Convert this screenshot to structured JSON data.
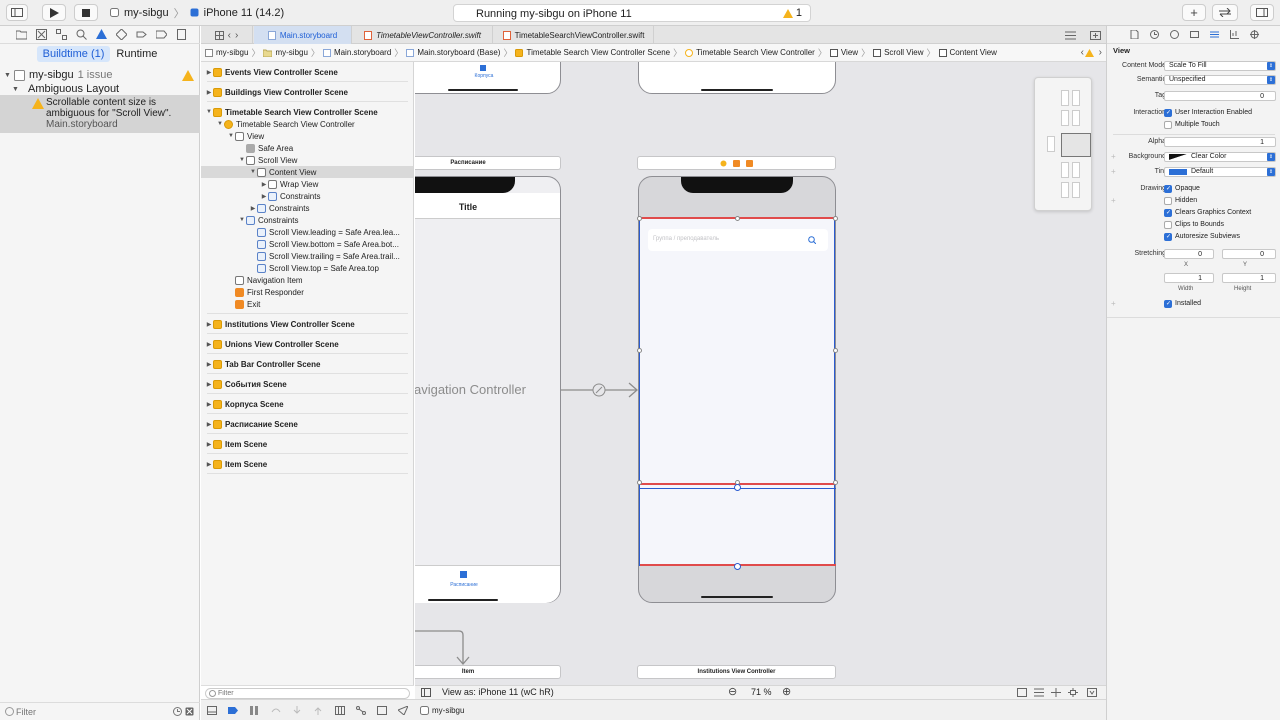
{
  "toolbar": {
    "scheme_name": "my-sibgu",
    "device_name": "iPhone 11 (14.2)",
    "activity_text": "Running my-sibgu on iPhone 11",
    "warning_count": "1"
  },
  "navigator": {
    "segments": [
      "Buildtime (1)",
      "Runtime"
    ],
    "project": "my-sibgu",
    "issue_count": "1 issue",
    "group": "Ambiguous Layout",
    "issue_line1": "Scrollable content size is",
    "issue_line2": "ambiguous for \"Scroll View\".",
    "issue_file": "Main.storyboard",
    "filter_placeholder": "Filter"
  },
  "tabs": [
    "Main.storyboard",
    "TimetableViewController.swift",
    "TimetableSearchViewController.swift"
  ],
  "jumpbar": [
    "my-sibgu",
    "my-sibgu",
    "Main.storyboard",
    "Main.storyboard (Base)",
    "Timetable Search View Controller Scene",
    "Timetable Search View Controller",
    "View",
    "Scroll View",
    "Content View"
  ],
  "outline": {
    "rows": [
      {
        "label": "Events View Controller Scene",
        "kind": "scene"
      },
      {
        "label": "Buildings View Controller Scene",
        "kind": "scene"
      },
      {
        "label": "Timetable Search View Controller Scene",
        "kind": "scene-open"
      },
      {
        "label": "Timetable Search View Controller",
        "kind": "vc"
      },
      {
        "label": "View",
        "kind": "view"
      },
      {
        "label": "Safe Area",
        "kind": "leaf"
      },
      {
        "label": "Scroll View",
        "kind": "view"
      },
      {
        "label": "Content View",
        "kind": "view"
      },
      {
        "label": "Wrap View",
        "kind": "view-closed"
      },
      {
        "label": "Constraints",
        "kind": "cons-closed"
      },
      {
        "label": "Constraints",
        "kind": "cons-closed"
      },
      {
        "label": "Constraints",
        "kind": "cons-open"
      },
      {
        "label": "Scroll View.leading = Safe Area.lea...",
        "kind": "constraint"
      },
      {
        "label": "Scroll View.bottom = Safe Area.bot...",
        "kind": "constraint"
      },
      {
        "label": "Scroll View.trailing = Safe Area.trail...",
        "kind": "constraint"
      },
      {
        "label": "Scroll View.top = Safe Area.top",
        "kind": "constraint"
      },
      {
        "label": "Navigation Item",
        "kind": "navitem"
      },
      {
        "label": "First Responder",
        "kind": "responder"
      },
      {
        "label": "Exit",
        "kind": "exit"
      },
      {
        "label": "Institutions View Controller Scene",
        "kind": "scene"
      },
      {
        "label": "Unions View Controller Scene",
        "kind": "scene"
      },
      {
        "label": "Tab Bar Controller Scene",
        "kind": "scene"
      },
      {
        "label": "События Scene",
        "kind": "scene"
      },
      {
        "label": "Корпуса Scene",
        "kind": "scene"
      },
      {
        "label": "Расписание Scene",
        "kind": "scene"
      },
      {
        "label": "Item Scene",
        "kind": "scene"
      },
      {
        "label": "Item Scene",
        "kind": "scene"
      }
    ],
    "filter_placeholder": "Filter"
  },
  "canvas": {
    "top_left_tab": "Корпуса",
    "scene_title_left": "Расписание",
    "phone_title": "Title",
    "nav_controller_label": "Navigation Controller",
    "tab_item_label": "Расписание",
    "search_placeholder": "Группа / преподаватель",
    "bottom_bar_left": "Item",
    "bottom_bar_right": "Institutions View Controller"
  },
  "canvas_bar": {
    "view_as": "View as: iPhone 11 (wC hR)",
    "zoom": "71 %"
  },
  "bottom": {
    "target": "my-sibgu"
  },
  "inspector": {
    "section": "View",
    "content_mode_label": "Content Mode",
    "content_mode": "Scale To Fill",
    "semantic_label": "Semantic",
    "semantic": "Unspecified",
    "tag_label": "Tag",
    "tag": "0",
    "interaction_label": "Interaction",
    "user_interaction": "User Interaction Enabled",
    "multiple_touch": "Multiple Touch",
    "alpha_label": "Alpha",
    "alpha": "1",
    "background_label": "Background",
    "background": "Clear Color",
    "tint_label": "Tint",
    "tint": "Default",
    "drawing_label": "Drawing",
    "opaque": "Opaque",
    "hidden": "Hidden",
    "clears_graphics": "Clears Graphics Context",
    "clips_to_bounds": "Clips to Bounds",
    "autoresize": "Autoresize Subviews",
    "stretching_label": "Stretching",
    "stretch_x": "0",
    "stretch_y": "0",
    "x_label": "X",
    "y_label": "Y",
    "stretch_w": "1",
    "stretch_h": "1",
    "width_label": "Width",
    "height_label": "Height",
    "installed": "Installed",
    "tint_color": "#2c6fd6"
  }
}
